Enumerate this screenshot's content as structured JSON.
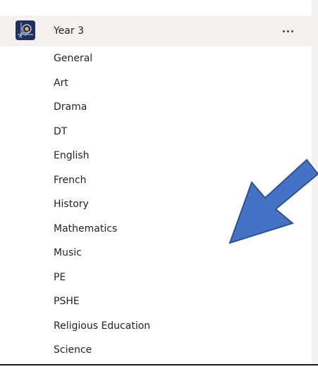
{
  "team": {
    "name": "Year 3",
    "avatar_icon": "team-logo-icon",
    "avatar_color": "#252f5b"
  },
  "channels": [
    "General",
    "Art",
    "Drama",
    "DT",
    "English",
    "French",
    "History",
    "Mathematics",
    "Music",
    "PE",
    "PSHE",
    "Religious Education",
    "Science"
  ],
  "colors": {
    "header_background": "#f3f2f1",
    "text": "#252423",
    "arrow_fill": "#4472c4",
    "arrow_stroke": "#2f528f"
  }
}
